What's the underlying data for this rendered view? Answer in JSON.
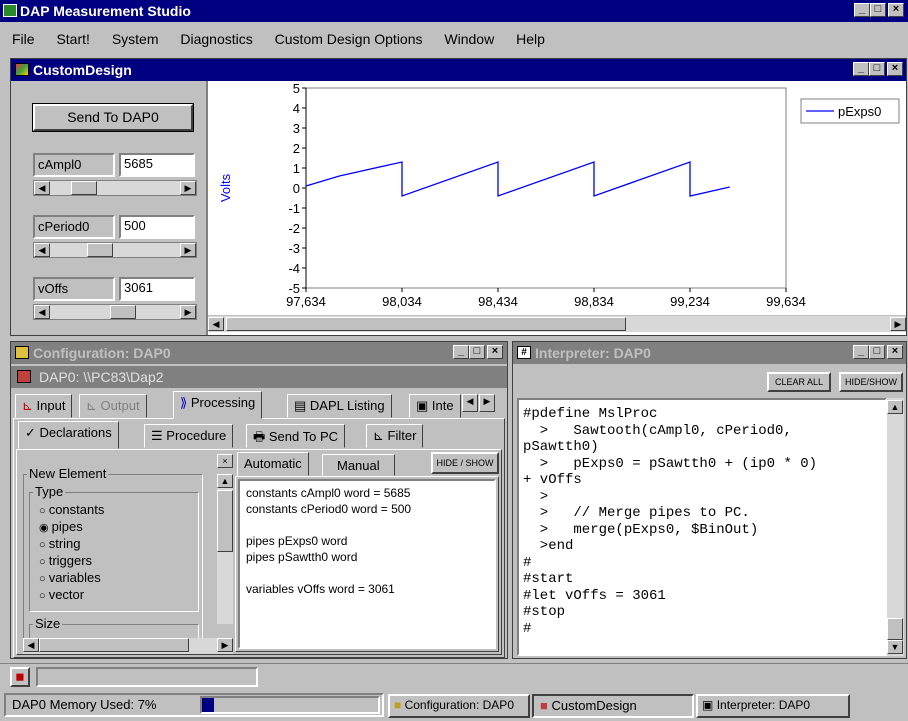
{
  "app": {
    "title": "DAP Measurement Studio"
  },
  "menu": [
    "File",
    "Start!",
    "System",
    "Diagnostics",
    "Custom Design Options",
    "Window",
    "Help"
  ],
  "custom_design": {
    "title": "CustomDesign",
    "send_button": "Send To DAP0",
    "controls": [
      {
        "label": "cAmpl0",
        "value": "5685",
        "slider_pos": 0.2
      },
      {
        "label": "cPeriod0",
        "value": "500",
        "slider_pos": 0.36
      },
      {
        "label": "vOffs",
        "value": "3061",
        "slider_pos": 0.58
      }
    ]
  },
  "chart_data": {
    "type": "line",
    "ylabel": "Volts",
    "ylim": [
      -5,
      5
    ],
    "xlim": [
      97634,
      99634
    ],
    "y_ticks": [
      "5",
      "4",
      "3",
      "2",
      "1",
      "0",
      "-1",
      "-2",
      "-3",
      "-4",
      "-5"
    ],
    "x_ticks": [
      "97,634",
      "98,034",
      "98,434",
      "98,834",
      "99,234",
      "99,634"
    ],
    "legend": [
      "pExps0"
    ],
    "series": [
      {
        "name": "pExps0",
        "color": "#0000ff",
        "x": [
          97634,
          97773,
          98034,
          98034,
          98034,
          98434,
          98434,
          98434,
          98834,
          98834,
          98834,
          99234,
          99234,
          99234,
          99400
        ],
        "y": [
          0.1,
          0.6,
          1.3,
          1.3,
          -0.4,
          1.3,
          1.3,
          -0.4,
          1.3,
          1.3,
          -0.4,
          1.3,
          1.3,
          -0.4,
          0.05
        ]
      }
    ]
  },
  "configuration": {
    "title": "Configuration: DAP0",
    "path": "DAP0: \\\\PC83\\Dap2",
    "main_tabs": [
      "Input",
      "Output",
      "Processing",
      "DAPL Listing",
      "Inte"
    ],
    "sub_tabs": [
      "Declarations",
      "Procedure",
      "Send To PC",
      "Filter"
    ],
    "new_element_label": "New Element",
    "type_label": "Type",
    "types": [
      "constants",
      "pipes",
      "string",
      "triggers",
      "variables",
      "vector"
    ],
    "selected_type": "pipes",
    "size_label": "Size",
    "mode_tabs": [
      "Automatic",
      "Manual"
    ],
    "hide_show": "HIDE / SHOW",
    "decl_lines": [
      "constants cAmpl0 word = 5685",
      "constants cPeriod0 word = 500",
      "",
      "pipes pExps0 word",
      "pipes pSawtth0 word",
      "",
      "variables vOffs word = 3061"
    ]
  },
  "interpreter": {
    "title": "Interpreter: DAP0",
    "clear_all": "CLEAR ALL",
    "hide_show": "HIDE/SHOW",
    "lines": [
      "#pdefine MslProc",
      "  >   Sawtooth(cAmpl0, cPeriod0,",
      "pSawtth0)",
      "  >   pExps0 = pSawtth0 + (ip0 * 0)",
      "+ vOffs",
      "  >",
      "  >   // Merge pipes to PC.",
      "  >   merge(pExps0, $BinOut)",
      "  >end",
      "#",
      "#start",
      "#let vOffs = 3061",
      "#stop",
      "#"
    ]
  },
  "status": {
    "memory": "DAP0 Memory Used:  7%",
    "memory_fraction": 0.07,
    "tasks": [
      "Configuration: DAP0",
      "CustomDesign",
      "Interpreter: DAP0"
    ]
  }
}
